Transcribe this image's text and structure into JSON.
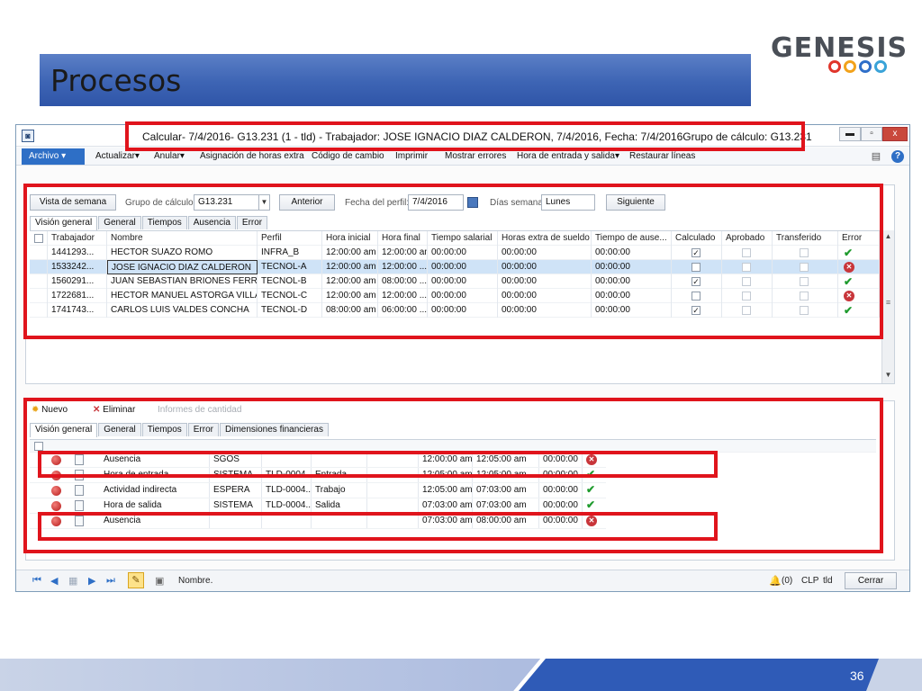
{
  "slide": {
    "title": "Procesos",
    "logo_text": "GENESIS",
    "page_number": "36"
  },
  "window": {
    "caption": "Calcular- 7/4/2016- G13.231 (1 - tld) - Trabajador: JOSE IGNACIO DIAZ CALDERON, 7/4/2016, Fecha: 7/4/2016Grupo de cálculo: G13.231",
    "minimize": "▬",
    "maximize": "▫",
    "close": "x"
  },
  "menu": {
    "archivo": "Archivo ▾",
    "items": [
      "Actualizar▾",
      "Anular▾",
      "Asignación de horas extra",
      "Código de cambio",
      "Imprimir",
      "Mostrar errores",
      "Hora de entrada y salida▾",
      "Restaurar líneas"
    ]
  },
  "filters": {
    "week_view_button": "Vista de semana",
    "group_label": "Grupo de cálculo:",
    "group_value": "G13.231",
    "prev_button": "Anterior",
    "profile_date_label": "Fecha del perfil:",
    "profile_date_value": "7/4/2016",
    "week_days_label": "Días semana:",
    "week_days_value": "Lunes",
    "next_button": "Siguiente"
  },
  "upper_tabs": [
    "Visión general",
    "General",
    "Tiempos",
    "Ausencia",
    "Error"
  ],
  "upper_grid": {
    "headers": [
      "Trabajador",
      "Nombre",
      "Perfil",
      "Hora inicial",
      "Hora final",
      "Tiempo salarial",
      "Horas extra de sueldo",
      "Tiempo de ause...",
      "Calculado",
      "Aprobado",
      "Transferido",
      "Error"
    ],
    "rows": [
      {
        "worker": "1441293...",
        "name": "HECTOR SUAZO  ROMO",
        "profile": "INFRA_B",
        "start": "12:00:00 am",
        "end": "12:00:00 am",
        "salary": "00:00:00",
        "overtime": "00:00:00",
        "absence": "00:00:00",
        "calculated": "✓",
        "error": "ok"
      },
      {
        "worker": "1533242...",
        "name": "JOSE IGNACIO DIAZ CALDERON",
        "profile": "TECNOL-A",
        "start": "12:00:00 am",
        "end": "12:00:00 ...",
        "salary": "00:00:00",
        "overtime": "00:00:00",
        "absence": "00:00:00",
        "calculated": "",
        "error": "err"
      },
      {
        "worker": "1560291...",
        "name": "JUAN SEBASTIAN BRIONES FERRADA",
        "profile": "TECNOL-B",
        "start": "12:00:00 am",
        "end": "08:00:00 ...",
        "salary": "00:00:00",
        "overtime": "00:00:00",
        "absence": "00:00:00",
        "calculated": "✓",
        "error": "ok"
      },
      {
        "worker": "1722681...",
        "name": "HECTOR MANUEL ASTORGA  VILLA...",
        "profile": "TECNOL-C",
        "start": "12:00:00 am",
        "end": "12:00:00 ...",
        "salary": "00:00:00",
        "overtime": "00:00:00",
        "absence": "00:00:00",
        "calculated": "",
        "error": "err"
      },
      {
        "worker": "1741743...",
        "name": "CARLOS LUIS VALDES  CONCHA",
        "profile": "TECNOL-D",
        "start": "08:00:00 am",
        "end": "06:00:00 ...",
        "salary": "00:00:00",
        "overtime": "00:00:00",
        "absence": "00:00:00",
        "calculated": "✓",
        "error": "ok"
      }
    ]
  },
  "lower_toolbar": {
    "new": "Nuevo",
    "delete": "Eliminar",
    "quantity_reports": "Informes de cantidad"
  },
  "lower_tabs": [
    "Visión general",
    "General",
    "Tiempos",
    "Error",
    "Dimensiones financieras"
  ],
  "lower_grid": {
    "rows": [
      {
        "type": "Ausencia",
        "reference": "SGOS",
        "job": "",
        "description": "",
        "start": "12:00:00 am",
        "end": "12:05:00 am",
        "time": "00:00:00",
        "error": "err"
      },
      {
        "type": "Hora de entrada",
        "reference": "SISTEMA",
        "job": "TLD-0004...",
        "description": "Entrada",
        "start": "12:05:00 am",
        "end": "12:05:00 am",
        "time": "00:00:00",
        "error": "ok"
      },
      {
        "type": "Actividad indirecta",
        "reference": "ESPERA",
        "job": "TLD-0004...",
        "description": "Trabajo",
        "start": "12:05:00 am",
        "end": "07:03:00 am",
        "time": "00:00:00",
        "error": "ok"
      },
      {
        "type": "Hora de salida",
        "reference": "SISTEMA",
        "job": "TLD-0004...",
        "description": "Salida",
        "start": "07:03:00 am",
        "end": "07:03:00 am",
        "time": "00:00:00",
        "error": "ok"
      },
      {
        "type": "Ausencia",
        "reference": "",
        "job": "",
        "description": "",
        "start": "07:03:00 am",
        "end": "08:00:00 am",
        "time": "00:00:00",
        "error": "err"
      }
    ]
  },
  "statusbar": {
    "text": "Nombre.",
    "alerts": "(0)",
    "currency": "CLP",
    "company": "tld",
    "close_button": "Cerrar"
  },
  "colors": {
    "annotation": "#e0141c",
    "title_band": "#3d64b4",
    "accent": "#2e6fc6"
  }
}
